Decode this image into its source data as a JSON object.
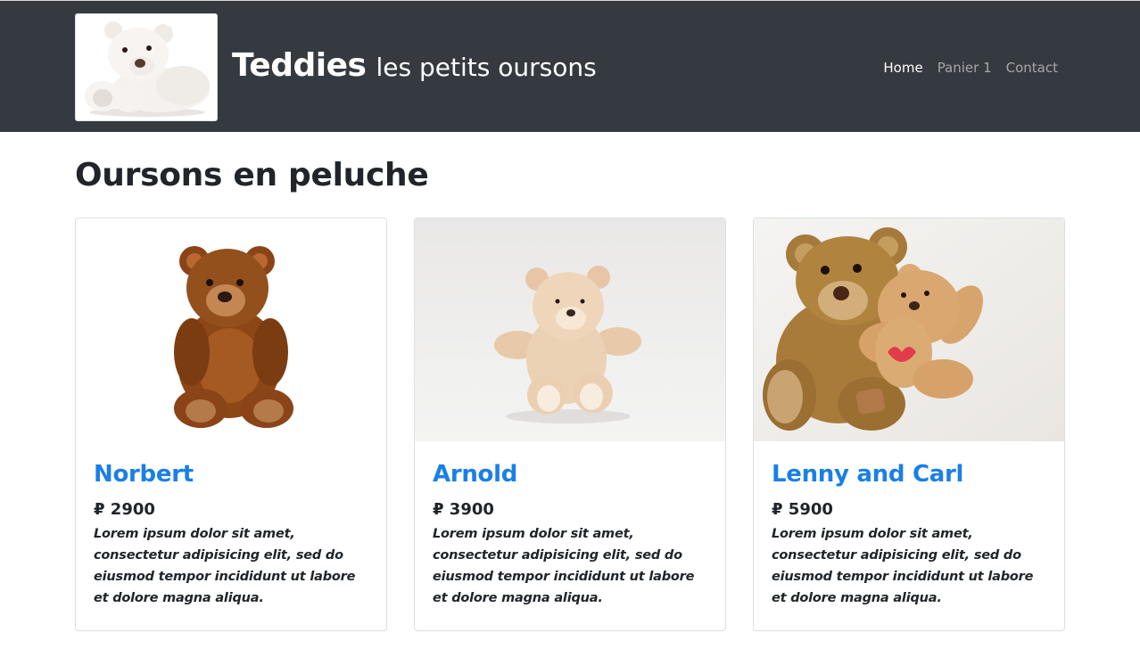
{
  "header": {
    "brand_name": "Teddies",
    "brand_tagline": "les petits oursons",
    "logo_icon": "teddy-bear-logo",
    "nav": [
      {
        "label": "Home",
        "active": true
      },
      {
        "label": "Panier 1",
        "active": false
      },
      {
        "label": "Contact",
        "active": false
      }
    ]
  },
  "main": {
    "title": "Oursons en peluche",
    "products": [
      {
        "name": "Norbert",
        "price": "₽ 2900",
        "description": "Lorem ipsum dolor sit amet, consectetur adipisicing elit, sed do eiusmod tempor incididunt ut labore et dolore magna aliqua.",
        "image_icon": "brown-teddy-bear-photo"
      },
      {
        "name": "Arnold",
        "price": "₽ 3900",
        "description": "Lorem ipsum dolor sit amet, consectetur adipisicing elit, sed do eiusmod tempor incididunt ut labore et dolore magna aliqua.",
        "image_icon": "beige-teddy-bear-photo"
      },
      {
        "name": "Lenny and Carl",
        "price": "₽ 5900",
        "description": "Lorem ipsum dolor sit amet, consectetur adipisicing elit, sed do eiusmod tempor incididunt ut labore et dolore magna aliqua.",
        "image_icon": "two-teddy-bears-photo"
      }
    ]
  },
  "colors": {
    "navbar_bg": "#343a40",
    "link_blue": "#1a7fe6",
    "text_dark": "#212529"
  }
}
